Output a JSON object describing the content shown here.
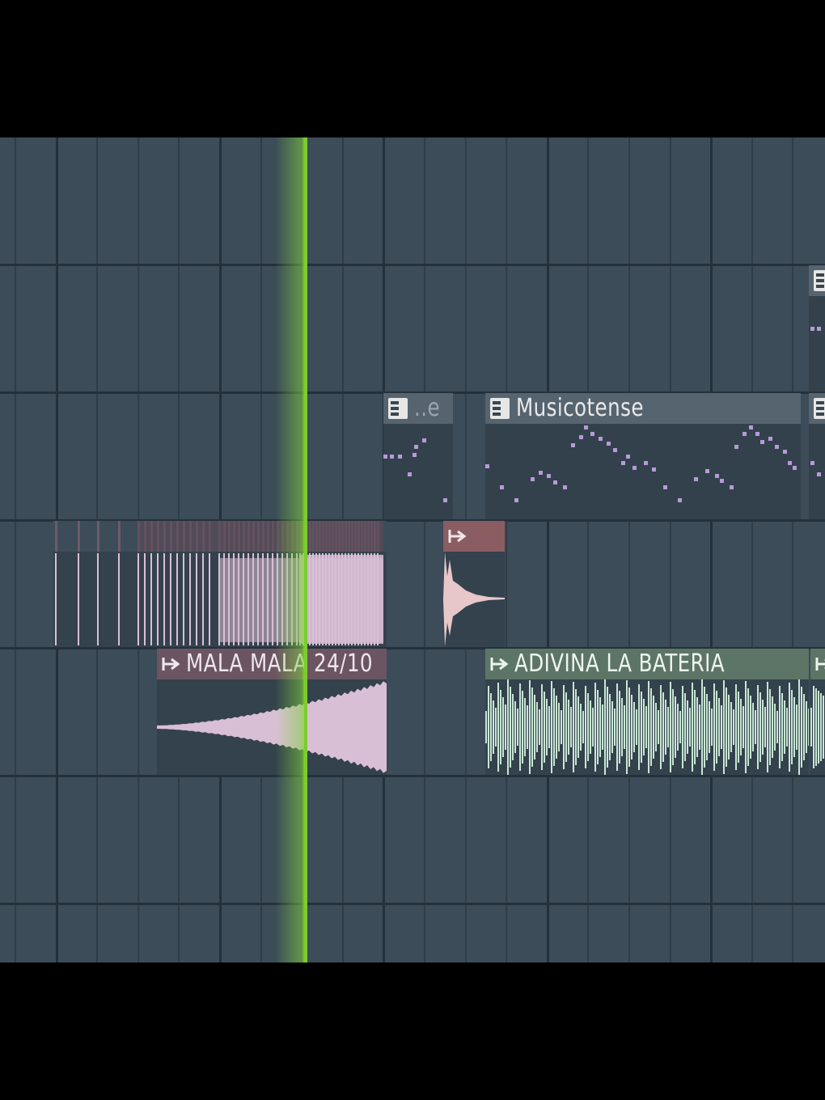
{
  "colors": {
    "background": "#3c4c58",
    "grid_minor": "#2f3d48",
    "grid_major": "#24313b",
    "playhead": "#7fd23a",
    "pattern_header": "#56646f",
    "pattern_body": "#33414c",
    "pattern_notes": "#b79ad8",
    "pink_header": "#6b5563",
    "pink_wave": "#d9bfd6",
    "salmon_header": "#8a5d63",
    "green_header": "#5d7566",
    "green_wave": "#c9e6d5",
    "text_light": "#e9e9e9",
    "text_dim": "#aab3ba"
  },
  "playlist": {
    "clips": [
      {
        "id": "pattern-truncated",
        "type": "pattern",
        "label": "..e",
        "icon": "piano-icon"
      },
      {
        "id": "pattern-musicotense",
        "type": "pattern",
        "label": "Musicotense",
        "icon": "piano-icon"
      },
      {
        "id": "pattern-edge-upper",
        "type": "pattern",
        "label": "",
        "icon": "piano-icon"
      },
      {
        "id": "pattern-edge-lower",
        "type": "pattern",
        "label": "",
        "icon": "piano-icon"
      },
      {
        "id": "audio-drum-hits",
        "type": "audio",
        "label": "",
        "icon": "audio-clip-icon"
      },
      {
        "id": "audio-short-hit",
        "type": "audio",
        "label": "",
        "icon": "audio-clip-icon"
      },
      {
        "id": "audio-mala-mala",
        "type": "audio",
        "label": "MALA MALA 24/10",
        "icon": "audio-clip-icon"
      },
      {
        "id": "audio-adivina",
        "type": "audio",
        "label": "ADIVINA LA BATERIA",
        "icon": "audio-clip-icon"
      },
      {
        "id": "audio-edge",
        "type": "audio",
        "label": "",
        "icon": "audio-clip-icon"
      }
    ]
  }
}
